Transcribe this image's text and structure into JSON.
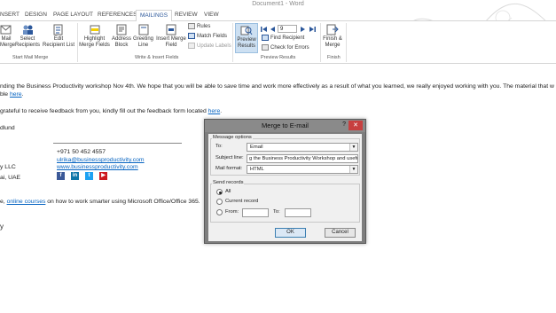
{
  "window": {
    "title": "Document1 - Word"
  },
  "tabs": [
    "NSERT",
    "DESIGN",
    "PAGE LAYOUT",
    "REFERENCES",
    "MAILINGS",
    "REVIEW",
    "VIEW"
  ],
  "active_tab": "MAILINGS",
  "ribbon": {
    "start_mail_merge": {
      "mail_label": "Mail",
      "merge_label": "Merge",
      "select_label": "Select",
      "recipients_label": "Recipients",
      "edit_label": "Edit",
      "recipient_list_label": "Recipient List",
      "group_label": "Start Mail Merge"
    },
    "write_insert": {
      "highlight_label": "Highlight",
      "merge_fields_label": "Merge Fields",
      "address_label": "Address",
      "block_label": "Block",
      "greeting_label": "Greeting",
      "line_label": "Line",
      "insert_merge_label": "Insert Merge",
      "field_label": "Field",
      "rules_label": "Rules",
      "match_fields_label": "Match Fields",
      "update_labels_label": "Update Labels",
      "group_label": "Write & Insert Fields"
    },
    "preview": {
      "preview_label": "Preview",
      "results_label": "Results",
      "record_number": "9",
      "find_recipient_label": "Find Recipient",
      "check_errors_label": "Check for Errors",
      "group_label": "Preview Results"
    },
    "finish": {
      "finish_label": "Finish &",
      "merge_label": "Merge",
      "group_label": "Finish"
    }
  },
  "document": {
    "line1": "nding the Business Productivity workshop Nov 4th. We hope that you will be able to save time and work more effectively as a result of what you learned, we really enjoyed working with you. The material that w",
    "line2_prefix": "ble ",
    "line2_link": "here",
    "line2_suffix": ".",
    "line3_prefix": "grateful to receive feedback from you, kindly fill out the feedback form located ",
    "line3_link": "here",
    "line3_suffix": ".",
    "signature_name": "dlund",
    "phone": "+971 50 452 4557",
    "email": "ulrika@businessproductivity.com",
    "website": "www.businessproductivity.com",
    "company_partial": "y LLC",
    "location_partial": "ai, UAE",
    "course_prefix": "e, ",
    "course_link": "online courses",
    "course_suffix": " on how to work smarter using Microsoft Office/Office 365.",
    "trailing": "y",
    "social_icons": [
      {
        "name": "facebook-icon",
        "glyph": "f",
        "color": "#3b5998"
      },
      {
        "name": "linkedin-icon",
        "glyph": "in",
        "color": "#0e76a8"
      },
      {
        "name": "twitter-icon",
        "glyph": "t",
        "color": "#1da1f2"
      },
      {
        "name": "youtube-icon",
        "glyph": "▶",
        "color": "#cc181e"
      }
    ]
  },
  "dialog": {
    "title": "Merge to E-mail",
    "help": "?",
    "close": "✕",
    "message_options_label": "Message options",
    "to_label": "To:",
    "to_value": "Email",
    "subject_label": "Subject line:",
    "subject_value": "g the Business Productivity Workshop and useful links",
    "mail_format_label": "Mail format:",
    "mail_format_value": "HTML",
    "send_records_label": "Send records",
    "all_label": "All",
    "current_label": "Current record",
    "from_label": "From:",
    "to_range_label": "To:",
    "ok_label": "OK",
    "cancel_label": "Cancel"
  },
  "colors": {
    "accent": "#2b579a",
    "link": "#0563c1",
    "preview_highlight": "#cde0f2"
  }
}
